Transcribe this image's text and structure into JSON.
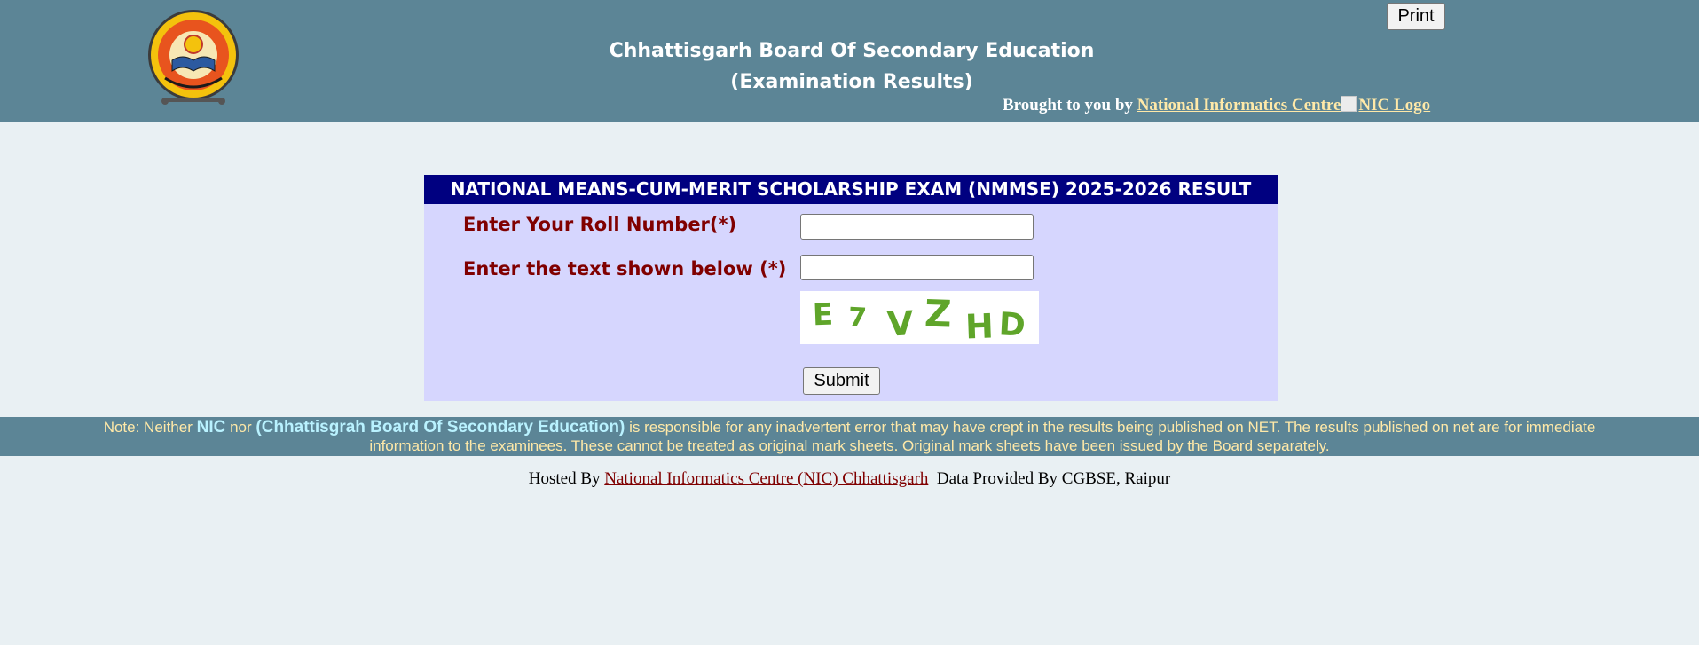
{
  "header": {
    "print_label": "Print",
    "title_line1": "Chhattisgarh Board Of Secondary Education",
    "title_line2": "(Examination Results)",
    "brought_prefix": "Brought to you by",
    "nic_link": "National Informatics Centre",
    "nic_logo_alt": "NIC Logo"
  },
  "form": {
    "heading": "NATIONAL MEANS-CUM-MERIT SCHOLARSHIP EXAM (NMMSE) 2025-2026 RESULT",
    "roll_label": "Enter Your Roll Number(*)",
    "roll_value": "",
    "captcha_label": "Enter the text shown below (*)",
    "captcha_value": "",
    "captcha_text": [
      "E",
      "7",
      "V",
      "Z",
      "H",
      "D"
    ],
    "submit_label": "Submit"
  },
  "note": {
    "prefix": "Note: Neither",
    "nic": "NIC",
    "nor": "nor",
    "board": "(Chhattisgrah Board Of Secondary Education)",
    "text": "is responsible for any inadvertent error that may have crept in the results being published on NET. The results published on net are for immediate information to the examinees. These cannot be treated as original mark sheets. Original mark sheets have been issued by the Board separately."
  },
  "footer": {
    "hosted_prefix": "Hosted By",
    "hosted_link": "National Informatics Centre (NIC) Chhattisgarh",
    "data_provided": "Data Provided By CGBSE, Raipur"
  },
  "colors": {
    "header_bg": "#5c8596",
    "page_bg": "#e9f0f3",
    "panel_bg": "#d6d6fe",
    "panel_header_bg": "#000080",
    "label_color": "#800000",
    "note_text": "#ffe9a8",
    "captcha_green": "#5fa52a"
  },
  "icons": {
    "logo": "cgbse-seal-logo",
    "nic_logo": "broken-image-icon"
  }
}
